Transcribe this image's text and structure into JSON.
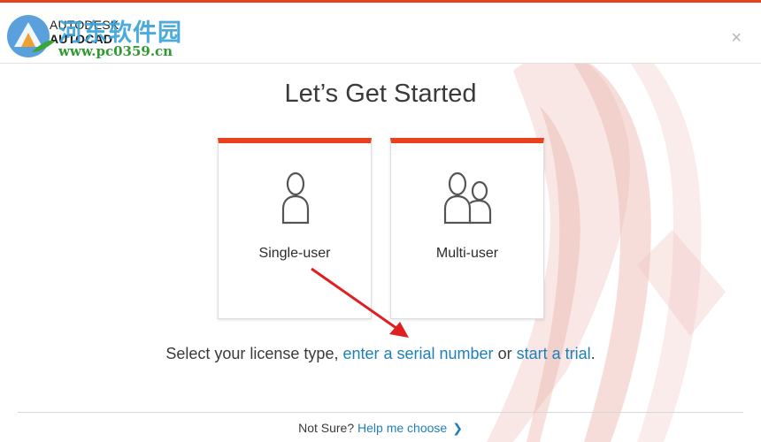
{
  "header": {
    "brand_line1": "AUTODESK",
    "brand_line2": "AUTOCAD",
    "close_symbol": "×"
  },
  "watermark": {
    "site_name_cn": "河东软件园",
    "site_url": "www.pc0359.cn"
  },
  "main": {
    "title": "Let’s Get Started",
    "cards": {
      "single": {
        "label": "Single-user",
        "icon": "single-person-icon"
      },
      "multi": {
        "label": "Multi-user",
        "icon": "two-people-icon"
      }
    },
    "license_prompt": {
      "prefix": "Select your license type, ",
      "serial_link": "enter a serial number",
      "middle": " or ",
      "trial_link": "start a trial",
      "suffix": "."
    }
  },
  "footer": {
    "not_sure": "Not Sure?",
    "help_link": "Help me choose",
    "chevron": "❯"
  },
  "colors": {
    "accent": "#e8411e",
    "link": "#1f7fb8",
    "annotation_arrow": "#e02020"
  }
}
